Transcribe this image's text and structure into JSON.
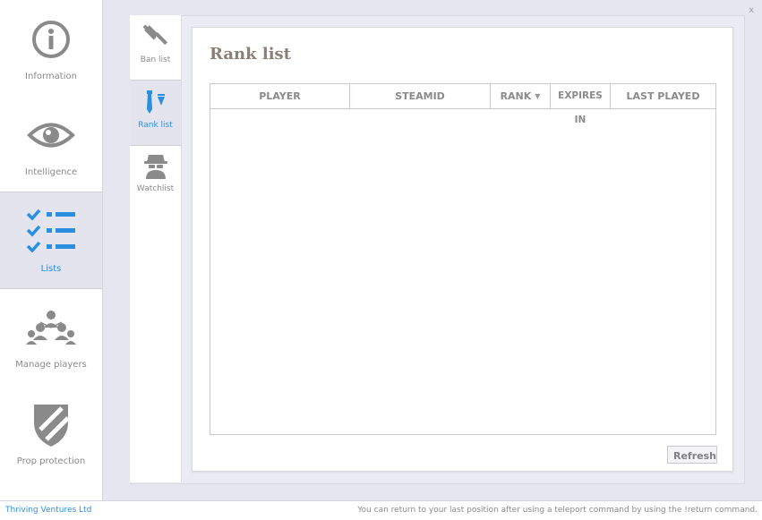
{
  "window": {
    "close_label": "x"
  },
  "nav": {
    "items": [
      {
        "label": "Information",
        "icon": "info-icon"
      },
      {
        "label": "Intelligence",
        "icon": "eye-icon"
      },
      {
        "label": "Lists",
        "icon": "checklist-icon",
        "active": true
      },
      {
        "label": "Manage players",
        "icon": "players-hierarchy-icon"
      },
      {
        "label": "Prop protection",
        "icon": "shield-icon"
      }
    ]
  },
  "subnav": {
    "items": [
      {
        "label": "Ban list",
        "icon": "gavel-icon"
      },
      {
        "label": "Rank list",
        "icon": "tie-icon",
        "active": true
      },
      {
        "label": "Watchlist",
        "icon": "spy-icon"
      }
    ]
  },
  "main": {
    "title": "Rank list",
    "table": {
      "columns": [
        "PLAYER",
        "STEAMID",
        "RANK",
        "EXPIRES IN",
        "LAST PLAYED"
      ],
      "sorted_column": "RANK",
      "rows": []
    },
    "refresh_label": "Refresh"
  },
  "statusbar": {
    "company": "Thriving Ventures Ltd",
    "tip": "You can return to your last position after using a teleport command by using the !return command."
  },
  "colors": {
    "accent": "#2b8fe0",
    "icon_gray": "#8a8a8a",
    "background": "#e6e6f0"
  }
}
